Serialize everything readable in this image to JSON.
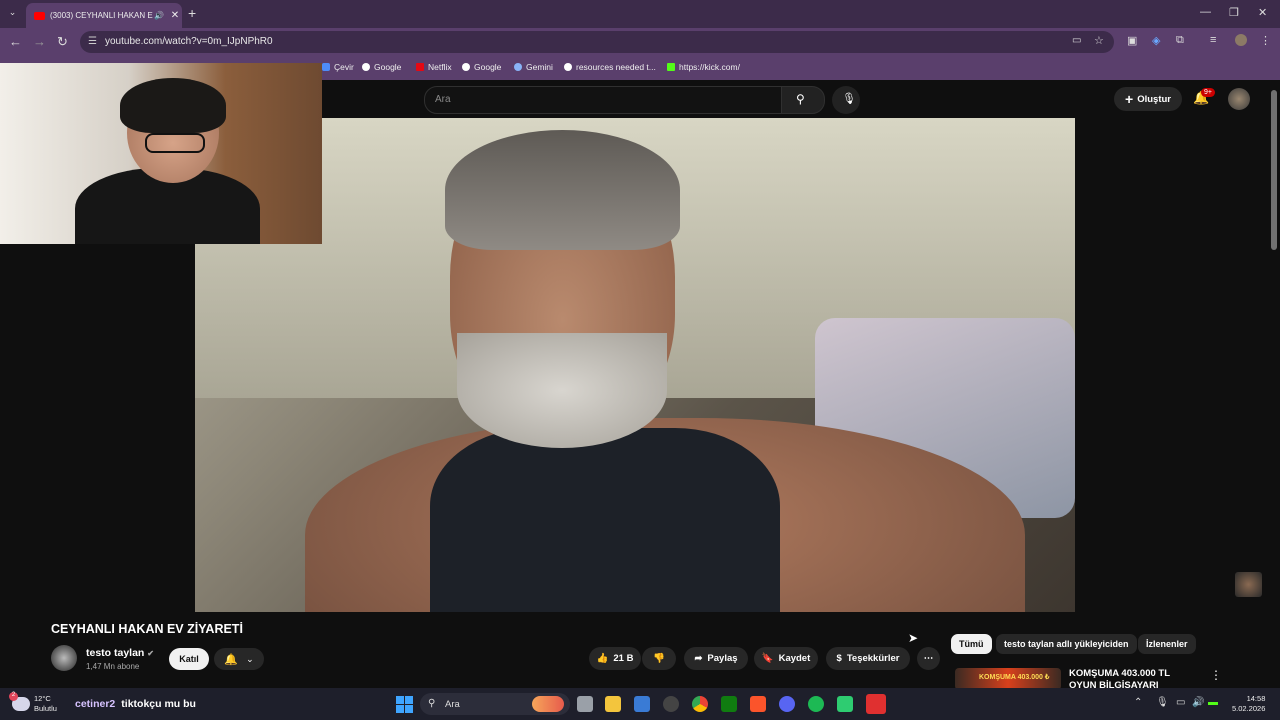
{
  "browser": {
    "tab_title": "(3003) CEYHANLI HAKAN E",
    "url": "youtube.com/watch?v=0m_IJpNPhR0",
    "bookmarks": [
      "Çevir",
      "Google",
      "Netflix",
      "Google",
      "Gemini",
      "resources needed t...",
      "https://kick.com/"
    ]
  },
  "youtube": {
    "search_placeholder": "Ara",
    "create_label": "Oluştur",
    "notification_badge": "9+",
    "video_title": "CEYHANLI HAKAN EV ZİYARETİ",
    "channel_name": "testo taylan",
    "subscribers": "1,47 Mn abone",
    "join_label": "Katıl",
    "like_count": "21 B",
    "share_label": "Paylaş",
    "save_label": "Kaydet",
    "thanks_label": "Teşekkürler",
    "chips": [
      "Tümü",
      "testo taylan adlı yükleyiciden",
      "İzlenenler"
    ],
    "rec_title": "KOMŞUMA 403.000 TL OYUN BİLGİSAYARI TOPLADIM",
    "rec_thumb_text": "KOMŞUMA 403.000 ₺"
  },
  "taskbar": {
    "temperature": "12°C",
    "weather": "Bulutlu",
    "weather_badge": "2",
    "chat_user": "cetiner2",
    "chat_message": "tiktokçu mu bu",
    "search_label": "Ara",
    "time": "14:58",
    "date": "5.02.2026"
  }
}
